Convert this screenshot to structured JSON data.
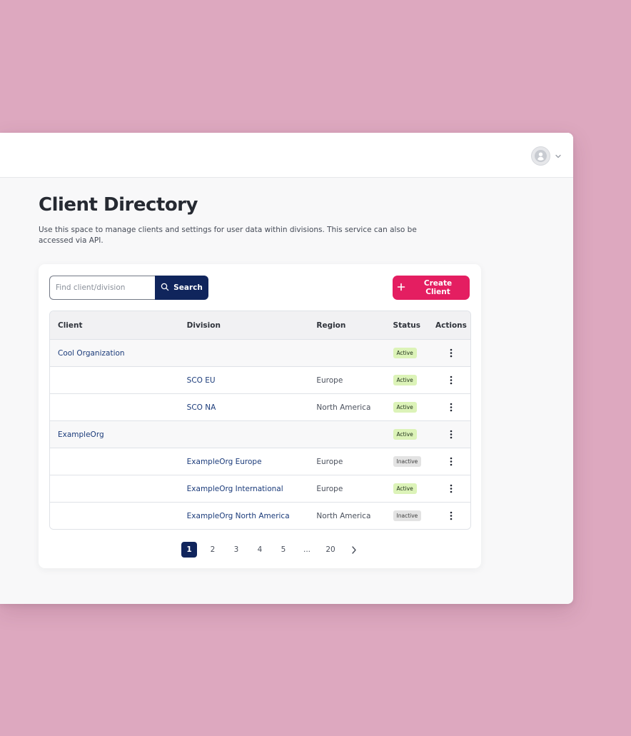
{
  "header": {
    "title": "Client Directory",
    "description": "Use this space to manage clients and settings for user data within divisions. This service can also be accessed via API."
  },
  "profile": {
    "avatar_icon": "user-avatar-icon",
    "dropdown_icon": "chevron-down-icon"
  },
  "search": {
    "placeholder": "Find client/division",
    "value": "",
    "button_label": "Search",
    "icon": "search-icon"
  },
  "actions": {
    "create_client_label": "Create Client",
    "create_icon": "plus-icon"
  },
  "table": {
    "columns": [
      "Client",
      "Division",
      "Region",
      "Status",
      "Actions"
    ],
    "rows": [
      {
        "client": "Cool Organization",
        "division": "",
        "region": "",
        "status": "Active"
      },
      {
        "client": "",
        "division": "SCO EU",
        "region": "Europe",
        "status": "Active"
      },
      {
        "client": "",
        "division": "SCO NA",
        "region": "North America",
        "status": "Active"
      },
      {
        "client": "ExampleOrg",
        "division": "",
        "region": "",
        "status": "Active"
      },
      {
        "client": "",
        "division": "ExampleOrg Europe",
        "region": "Europe",
        "status": "Inactive"
      },
      {
        "client": "",
        "division": "ExampleOrg International",
        "region": "Europe",
        "status": "Active"
      },
      {
        "client": "",
        "division": "ExampleOrg North America",
        "region": "North America",
        "status": "Inactive"
      }
    ],
    "row_action_icon": "more-vertical-icon"
  },
  "pagination": {
    "pages": [
      "1",
      "2",
      "3",
      "4",
      "5"
    ],
    "ellipsis": "...",
    "last_page": "20",
    "current_page": "1",
    "next_icon": "chevron-right-icon"
  },
  "colors": {
    "page_background": "#dda8bf",
    "navy": "#10255c",
    "brand_pink": "#e41e61",
    "active_badge": "#dcf3b8",
    "inactive_badge": "#e3e3e3"
  }
}
